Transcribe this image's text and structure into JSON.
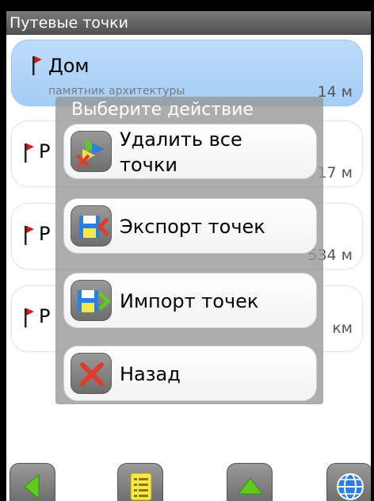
{
  "window": {
    "title": "Путевые точки"
  },
  "waypoints": [
    {
      "name": "Дом",
      "subtitle": "памятник архитектуры",
      "distance": "14 м",
      "selected": true
    },
    {
      "name": "Р",
      "subtitle": "",
      "distance": "17 м",
      "selected": false
    },
    {
      "name": "Р",
      "subtitle": "",
      "distance": "534 м",
      "selected": false
    },
    {
      "name": "Р",
      "subtitle": "",
      "distance": "км",
      "selected": false
    }
  ],
  "dialog": {
    "title": "Выберите действие",
    "actions": [
      {
        "label_line1": "Удалить все",
        "label_line2": "точки",
        "icon": "delete-all-points-icon"
      },
      {
        "label": "Экспорт точек",
        "icon": "export-points-icon"
      },
      {
        "label": "Импорт точек",
        "icon": "import-points-icon"
      },
      {
        "label": "Назад",
        "icon": "close-icon"
      }
    ]
  },
  "toolbar": {
    "buttons": [
      {
        "icon": "back-arrow-icon"
      },
      {
        "icon": "list-icon"
      },
      {
        "icon": "up-arrow-icon"
      },
      {
        "icon": "globe-icon"
      }
    ]
  },
  "colors": {
    "selected_item": "#a5cdf5",
    "flag_red": "#d11a1a",
    "green_accent": "#5ecb1e",
    "blue_accent": "#2a7fe0",
    "overlay_gray": "#969696"
  }
}
